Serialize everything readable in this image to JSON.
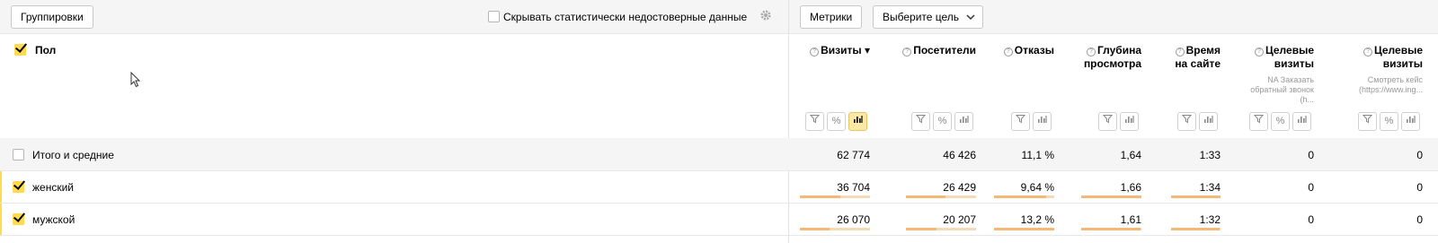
{
  "toolbar": {
    "groupings_button": "Группировки",
    "hide_unreliable_label": "Скрывать статистически недостоверные данные",
    "metrics_button": "Метрики",
    "goal_select": "Выберите цель"
  },
  "dimension_header": "Пол",
  "columns": [
    {
      "title": "Визиты ▾",
      "sub": ""
    },
    {
      "title": "Посетители",
      "sub": ""
    },
    {
      "title": "Отказы",
      "sub": ""
    },
    {
      "title": "Глубина просмотра",
      "sub": ""
    },
    {
      "title": "Время на сайте",
      "sub": ""
    },
    {
      "title": "Целевые визиты",
      "sub": "NA Заказать обратный звонок (h..."
    },
    {
      "title": "Целевые визиты",
      "sub": "Смотреть кейс (https://www.ing..."
    }
  ],
  "totals": {
    "label": "Итого и средние",
    "values": [
      "62 774",
      "46 426",
      "11,1 %",
      "1,64",
      "1:33",
      "0",
      "0"
    ]
  },
  "rows": [
    {
      "label": "женский",
      "values": [
        "36 704",
        "26 429",
        "9,64 %",
        "1,66",
        "1:34",
        "0",
        "0"
      ],
      "shares": [
        0.58,
        0.57,
        0.87,
        1.01,
        1.01
      ]
    },
    {
      "label": "мужской",
      "values": [
        "26 070",
        "20 207",
        "13,2 %",
        "1,61",
        "1:32",
        "0",
        "0"
      ],
      "shares": [
        0.42,
        0.44,
        1.19,
        0.98,
        0.99
      ]
    }
  ],
  "icons": {
    "filter": "filter-icon",
    "percent": "percent-icon",
    "chart": "chart-icon",
    "gear": "gear-icon"
  }
}
